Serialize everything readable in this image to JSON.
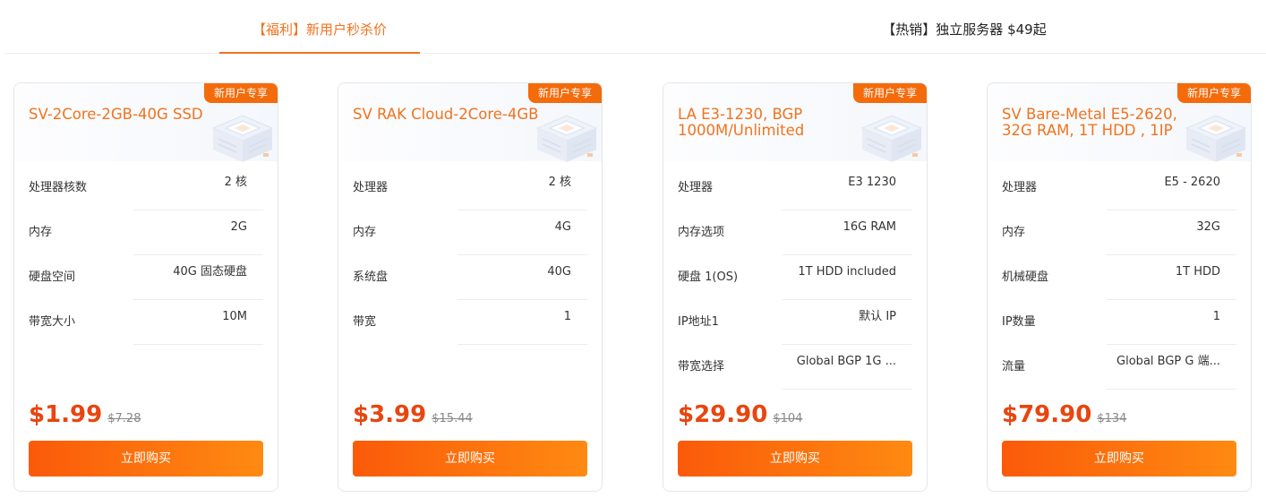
{
  "tabs": [
    {
      "label": "【福利】新用户秒杀价",
      "active": true
    },
    {
      "label": "【热销】独立服务器 $49起",
      "active": false
    }
  ],
  "colors": {
    "accent": "#f0731e",
    "price": "#e8450f",
    "button_start": "#fb5a09",
    "button_end": "#fe8a12",
    "badge": "#f46b0b"
  },
  "icons": {
    "card_art": "server-cube-icon"
  },
  "cards": [
    {
      "badge": "新用户专享",
      "title": "SV-2Core-2GB-40G SSD",
      "specs": [
        {
          "label": "处理器核数",
          "value": "2 核"
        },
        {
          "label": "内存",
          "value": "2G"
        },
        {
          "label": "硬盘空间",
          "value": "40G 固态硬盘"
        },
        {
          "label": "带宽大小",
          "value": "10M"
        }
      ],
      "price": "$1.99",
      "old_price": "$7.28",
      "button": "立即购买"
    },
    {
      "badge": "新用户专享",
      "title": "SV RAK Cloud-2Core-4GB",
      "specs": [
        {
          "label": "处理器",
          "value": "2 核"
        },
        {
          "label": "内存",
          "value": "4G"
        },
        {
          "label": "系统盘",
          "value": "40G"
        },
        {
          "label": "带宽",
          "value": "1"
        }
      ],
      "price": "$3.99",
      "old_price": "$15.44",
      "button": "立即购买"
    },
    {
      "badge": "新用户专享",
      "title": "LA E3-1230, BGP 1000M/Unlimited",
      "specs": [
        {
          "label": "处理器",
          "value": "E3 1230"
        },
        {
          "label": "内存选项",
          "value": "16G RAM"
        },
        {
          "label": "硬盘 1(OS)",
          "value": "1T HDD included"
        },
        {
          "label": "IP地址1",
          "value": "默认 IP"
        },
        {
          "label": "带宽选择",
          "value": "Global BGP 1G ..."
        }
      ],
      "price": "$29.90",
      "old_price": "$104",
      "button": "立即购买"
    },
    {
      "badge": "新用户专享",
      "title": "SV Bare-Metal E5-2620, 32G RAM, 1T HDD , 1IP",
      "specs": [
        {
          "label": "处理器",
          "value": "E5 - 2620"
        },
        {
          "label": "内存",
          "value": "32G"
        },
        {
          "label": "机械硬盘",
          "value": "1T HDD"
        },
        {
          "label": "IP数量",
          "value": "1"
        },
        {
          "label": "流量",
          "value": "Global BGP G 端..."
        }
      ],
      "price": "$79.90",
      "old_price": "$134",
      "button": "立即购买"
    }
  ]
}
